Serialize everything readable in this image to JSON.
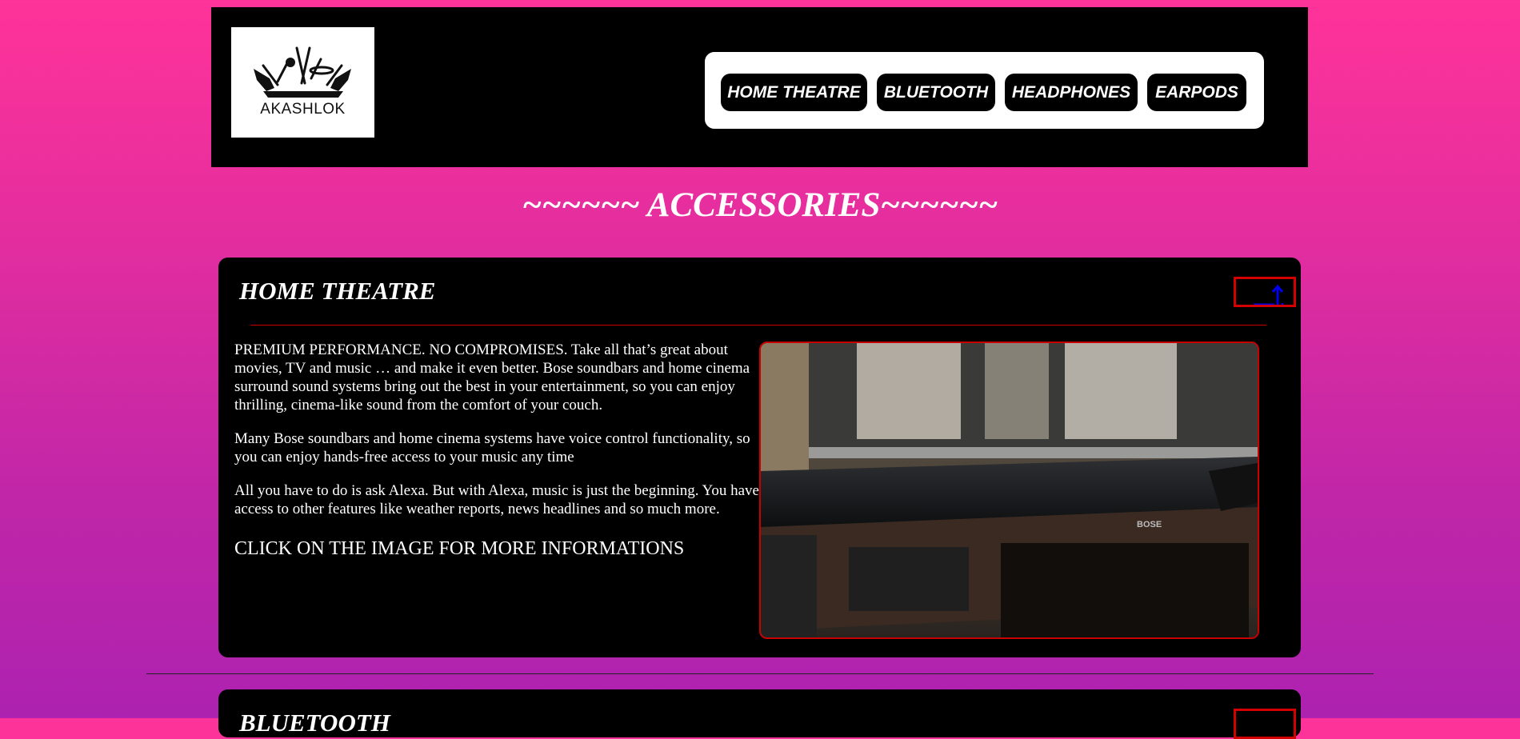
{
  "header": {
    "logo_text": "AKASHLOK",
    "nav": [
      {
        "label": "HOME THEATRE"
      },
      {
        "label": "BLUETOOTH"
      },
      {
        "label": "HEADPHONES"
      },
      {
        "label": "EARPODS"
      }
    ]
  },
  "page_title": "~~~~~~ ACCESSORIES~~~~~~",
  "sections": [
    {
      "title": "HOME THEATRE",
      "paragraphs": [
        "PREMIUM PERFORMANCE. NO COMPROMISES. Take all that’s great about movies, TV and music … and make it even better. Bose soundbars and home cinema surround sound systems bring out the best in your entertainment, so you can enjoy thrilling, cinema-like sound from the comfort of your couch.",
        "Many Bose soundbars and home cinema systems have voice control functionality, so you can enjoy hands-free access to your music any time",
        "All you have to do is ask Alexa. But with Alexa, music is just the beginning. You have access to other features like weather reports, news headlines and so much more."
      ],
      "cta": "CLICK ON THE IMAGE FOR MORE INFORMATIONS",
      "image_brand": "BOSE",
      "top_icon": "arrow-up-icon"
    },
    {
      "title": "BLUETOOTH",
      "top_icon": "arrow-up-icon"
    }
  ],
  "colors": {
    "accent": "#c80000",
    "link": "#0000ee",
    "panel": "#000000",
    "bg_top": "#ff3399",
    "bg_bottom": "#ad22b0"
  }
}
